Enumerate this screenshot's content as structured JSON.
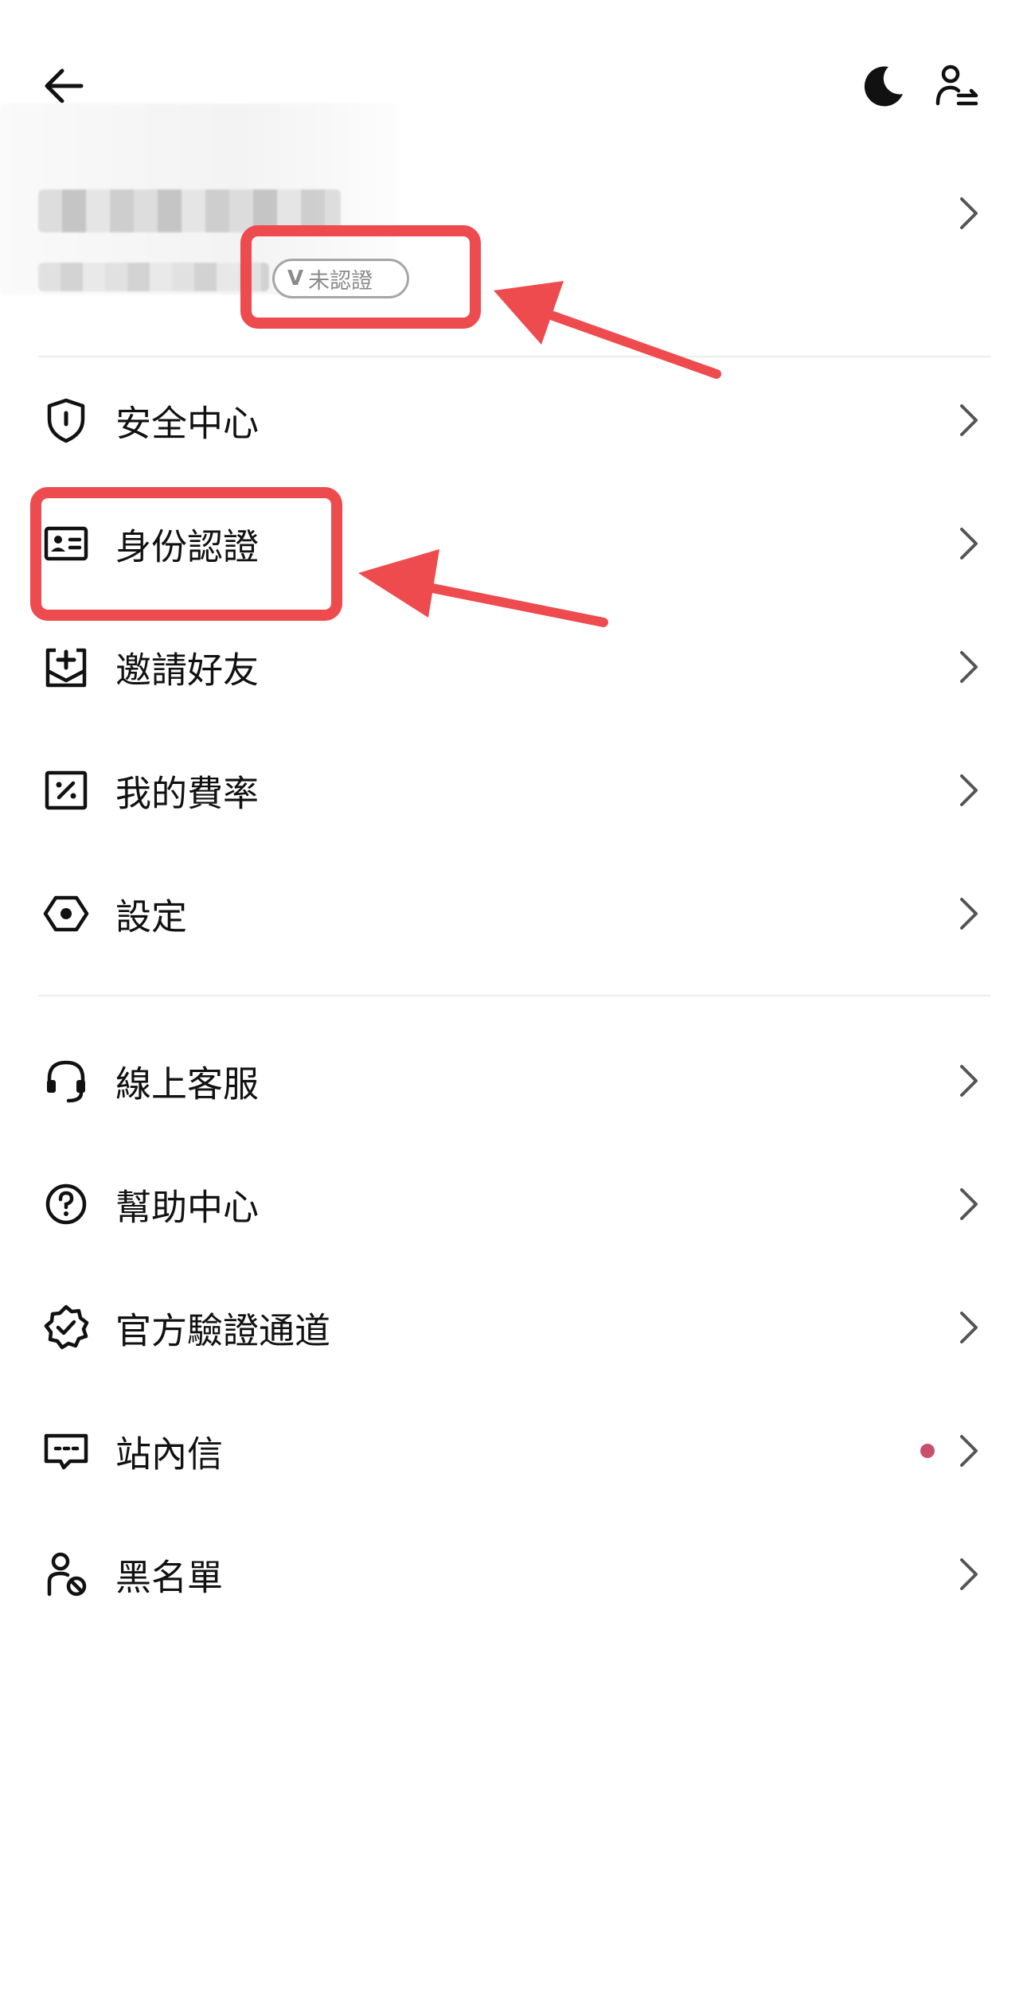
{
  "header": {
    "back_icon": "arrow-left-icon",
    "theme_icon": "moon-icon",
    "account_switch_icon": "user-switch-icon"
  },
  "profile": {
    "badge_label": "未認證",
    "badge_logo": "V"
  },
  "menu_group_1": [
    {
      "label": "安全中心",
      "icon": "shield-icon"
    },
    {
      "label": "身份認證",
      "icon": "id-card-icon"
    },
    {
      "label": "邀請好友",
      "icon": "invite-icon"
    },
    {
      "label": "我的費率",
      "icon": "fee-rate-icon"
    },
    {
      "label": "設定",
      "icon": "settings-hex-icon"
    }
  ],
  "menu_group_2": [
    {
      "label": "線上客服",
      "icon": "headset-icon"
    },
    {
      "label": "幫助中心",
      "icon": "help-circle-icon"
    },
    {
      "label": "官方驗證通道",
      "icon": "verified-badge-icon"
    },
    {
      "label": "站內信",
      "icon": "message-icon",
      "unread": true
    },
    {
      "label": "黑名單",
      "icon": "blocked-user-icon"
    }
  ],
  "colors": {
    "annotation_red": "#ee4b4f",
    "unread_dot": "#c9506a",
    "divider": "#ececec"
  }
}
